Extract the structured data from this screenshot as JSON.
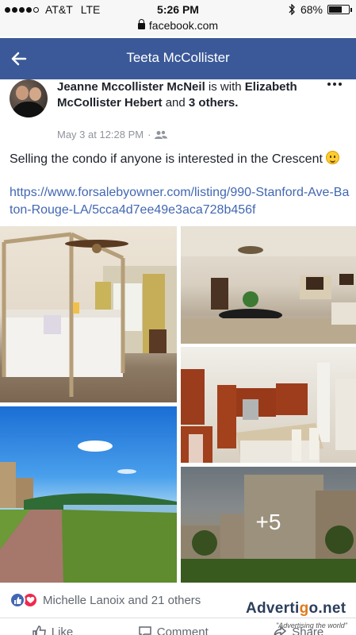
{
  "status_bar": {
    "carrier": "AT&T",
    "network": "LTE",
    "time": "5:26 PM",
    "battery": "68%",
    "battery_level": 0.68
  },
  "url_bar": {
    "domain": "facebook.com"
  },
  "header": {
    "title": "Teeta McCollister"
  },
  "post": {
    "author": "Jeanne Mccollister McNeil",
    "with_word": "is with",
    "tagged": "Elizabeth McCollister Hebert",
    "and_word": "and",
    "others": "3 others.",
    "date": "May 3 at 12:28 PM",
    "separator": "·",
    "audience_icon": "friends-icon",
    "text": "Selling the condo if anyone is interested in the Crescent",
    "link": "https://www.forsalebyowner.com/listing/990-Stanford-Ave-Baton-Rouge-LA/5cca4d7ee49e3aca728b456f",
    "more_photos": "+5"
  },
  "reactions": {
    "summary": "Michelle Lanoix and 21 others",
    "icons": [
      "like-icon",
      "love-icon"
    ]
  },
  "actions": {
    "like": "Like",
    "comment": "Comment",
    "share": "Share"
  },
  "watermark": {
    "logo_prefix": "Adverti",
    "logo_g": "g",
    "logo_suffix": "o.net",
    "tagline": "\"Advertising the world\""
  }
}
